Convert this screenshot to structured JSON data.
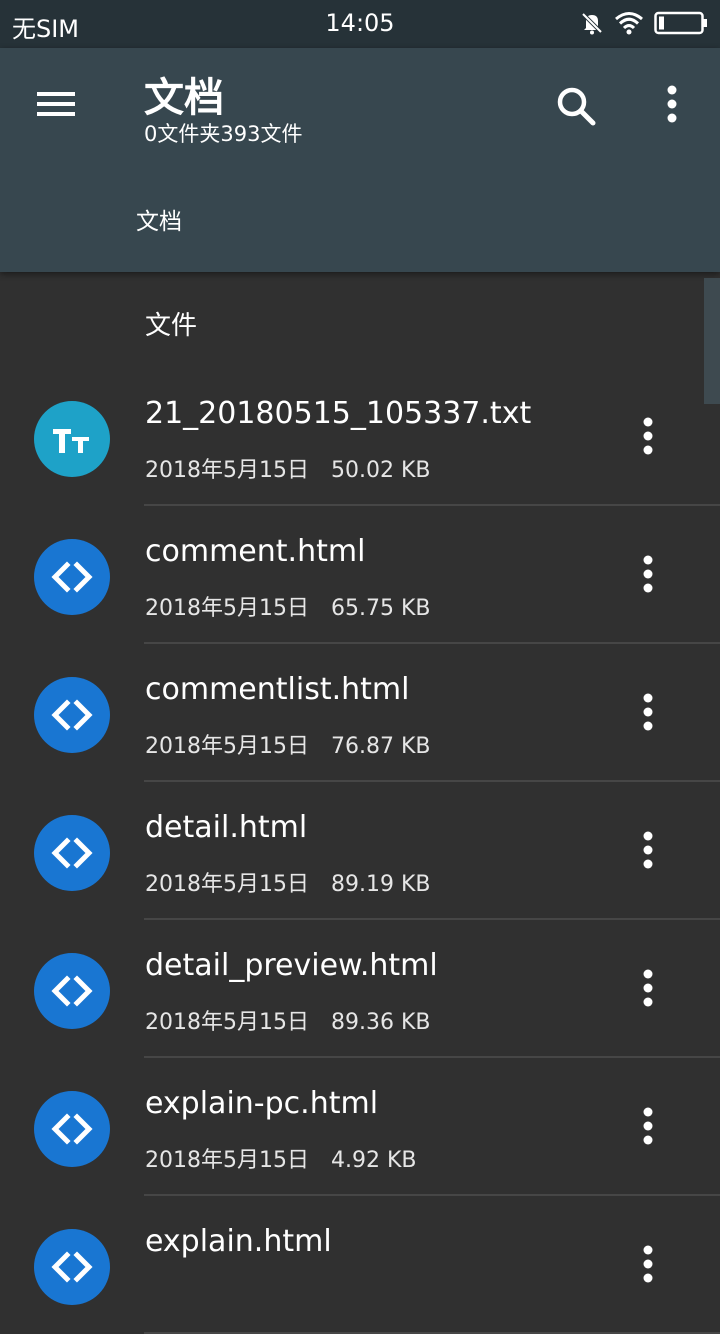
{
  "status_bar": {
    "carrier": "无SIM",
    "time": "14:05"
  },
  "app_bar": {
    "title": "文档",
    "subtitle": "0文件夹393文件",
    "breadcrumb": "文档",
    "icons": {
      "menu": "menu-icon",
      "search": "search-icon",
      "more": "more-vert-icon"
    }
  },
  "list": {
    "section_header": "文件",
    "files": [
      {
        "name": "21_20180515_105337.txt",
        "date": "2018年5月15日",
        "size": "50.02 KB",
        "type": "text",
        "icon_color": "#1ea2c8"
      },
      {
        "name": "comment.html",
        "date": "2018年5月15日",
        "size": "65.75 KB",
        "type": "code",
        "icon_color": "#1976d2"
      },
      {
        "name": "commentlist.html",
        "date": "2018年5月15日",
        "size": "76.87 KB",
        "type": "code",
        "icon_color": "#1976d2"
      },
      {
        "name": "detail.html",
        "date": "2018年5月15日",
        "size": "89.19 KB",
        "type": "code",
        "icon_color": "#1976d2"
      },
      {
        "name": "detail_preview.html",
        "date": "2018年5月15日",
        "size": "89.36 KB",
        "type": "code",
        "icon_color": "#1976d2"
      },
      {
        "name": "explain-pc.html",
        "date": "2018年5月15日",
        "size": "4.92 KB",
        "type": "code",
        "icon_color": "#1976d2"
      },
      {
        "name": "explain.html",
        "date": "",
        "size": "",
        "type": "code",
        "icon_color": "#1976d2"
      }
    ]
  },
  "colors": {
    "status_bar": "#263238",
    "app_bar": "#37474f",
    "background": "#303030",
    "divider": "#464646"
  }
}
